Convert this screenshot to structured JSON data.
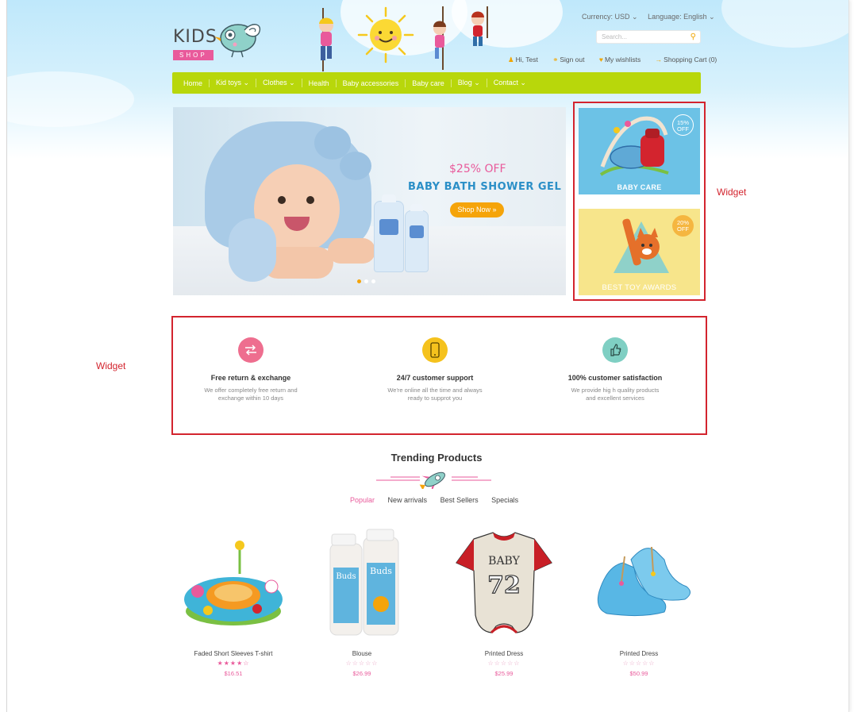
{
  "header": {
    "logo_text": "KIDS",
    "logo_sub": "SHOP",
    "currency": "Currency: USD ⌄",
    "language": "Language: English ⌄",
    "search_placeholder": "Search...",
    "user_greeting": "Hi, Test",
    "sign_out": "Sign out",
    "wishlists": "My wishlists",
    "cart": "Shopping Cart (0)"
  },
  "nav": {
    "items": [
      "Home",
      "Kid toys ⌄",
      "Clothes ⌄",
      "Health",
      "Baby accessories",
      "Baby care",
      "Blog ⌄",
      "Contact ⌄"
    ]
  },
  "hero": {
    "offer": "$25% OFF",
    "title": "BABY BATH SHOWER GEL",
    "button": "Shop Now »"
  },
  "banners": [
    {
      "label": "BABY CARE",
      "badge_value": "15%",
      "badge_unit": "OFF"
    },
    {
      "label": "BEST TOY AWARDS",
      "badge_value": "20%",
      "badge_unit": "OFF"
    }
  ],
  "annotations": {
    "widget_right": "Widget",
    "widget_left": "Widget"
  },
  "features": [
    {
      "title": "Free return & exchange",
      "desc": "We offer completely free return and exchange within 10 days"
    },
    {
      "title": "24/7 customer support",
      "desc": "We're online all the time and always ready to supprot you"
    },
    {
      "title": "100% customer satisfaction",
      "desc": "We provide hig h quality products and excellent services"
    }
  ],
  "trending": {
    "title": "Trending Products",
    "tabs": [
      "Popular",
      "New arrivals",
      "Best Sellers",
      "Specials"
    ]
  },
  "products": [
    {
      "name": "Faded Short Sleeves T-shirt",
      "stars": "★★★★☆",
      "rating": 4,
      "price": "$16.51"
    },
    {
      "name": "Blouse",
      "stars": "☆☆☆☆☆",
      "rating": 0,
      "price": "$26.99"
    },
    {
      "name": "Printed Dress",
      "stars": "☆☆☆☆☆",
      "rating": 0,
      "price": "$25.99"
    },
    {
      "name": "Printed Dress",
      "stars": "☆☆☆☆☆",
      "rating": 0,
      "price": "$50.99"
    }
  ],
  "product_art": {
    "jersey_text_top": "BABY",
    "jersey_text_num": "72",
    "bottle_text": "Buds"
  },
  "colors": {
    "nav_bg": "#b8d70b",
    "accent_pink": "#e95a9b",
    "accent_orange": "#f5a40a",
    "annotation_red": "#d3242e",
    "hero_title_blue": "#2b8fc7"
  }
}
